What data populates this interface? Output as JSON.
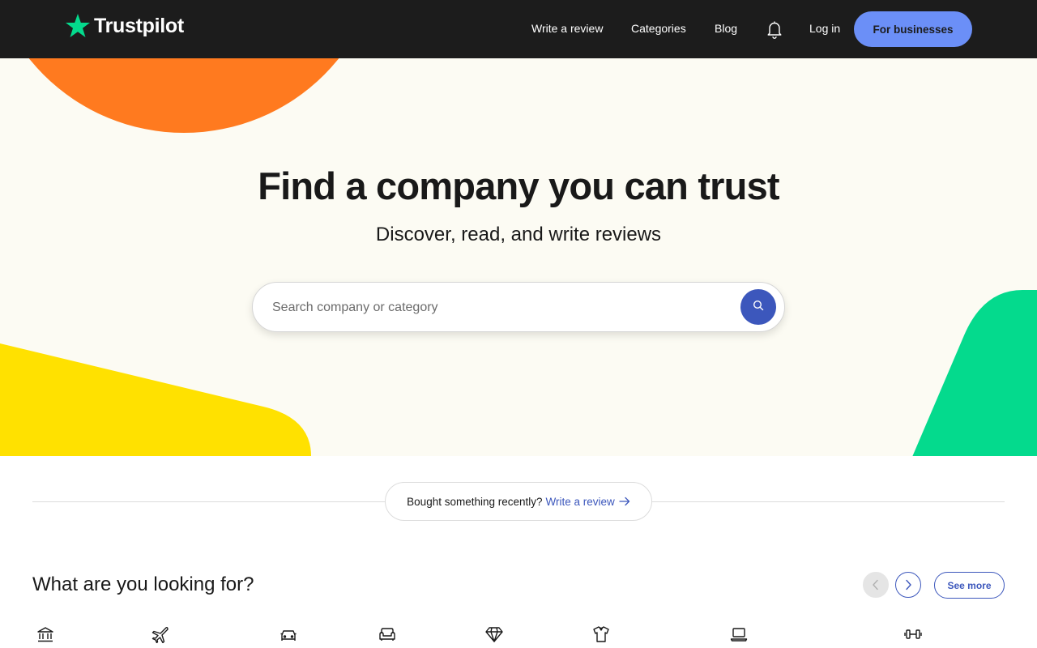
{
  "header": {
    "logo_text": "Trustpilot",
    "nav": {
      "write_review": "Write a review",
      "categories": "Categories",
      "blog": "Blog",
      "login": "Log in",
      "for_businesses": "For businesses"
    },
    "icons": {
      "logo": "star-icon",
      "notifications": "bell-icon"
    }
  },
  "hero": {
    "title": "Find a company you can trust",
    "subtitle": "Discover, read, and write reviews",
    "search": {
      "placeholder": "Search company or category",
      "value": "",
      "button_icon": "search-icon"
    }
  },
  "recent": {
    "text": "Bought something recently?",
    "link": "Write a review",
    "link_icon": "arrow-right-icon"
  },
  "categories_section": {
    "title": "What are you looking for?",
    "see_more": "See more",
    "prev_icon": "chevron-left-icon",
    "next_icon": "chevron-right-icon",
    "icons": [
      "bank-icon",
      "airplane-icon",
      "car-icon",
      "sofa-icon",
      "diamond-icon",
      "shirt-icon",
      "laptop-icon",
      "dumbbell-icon"
    ]
  },
  "colors": {
    "header_bg": "#1c1c1c",
    "brand_green": "#04da8d",
    "button_blue": "#6b8ff7",
    "accent_blue": "#3c57bc",
    "hero_bg": "#fcfbf3",
    "orange": "#ff7a1f",
    "yellow": "#ffe100",
    "green": "#04da8d"
  }
}
